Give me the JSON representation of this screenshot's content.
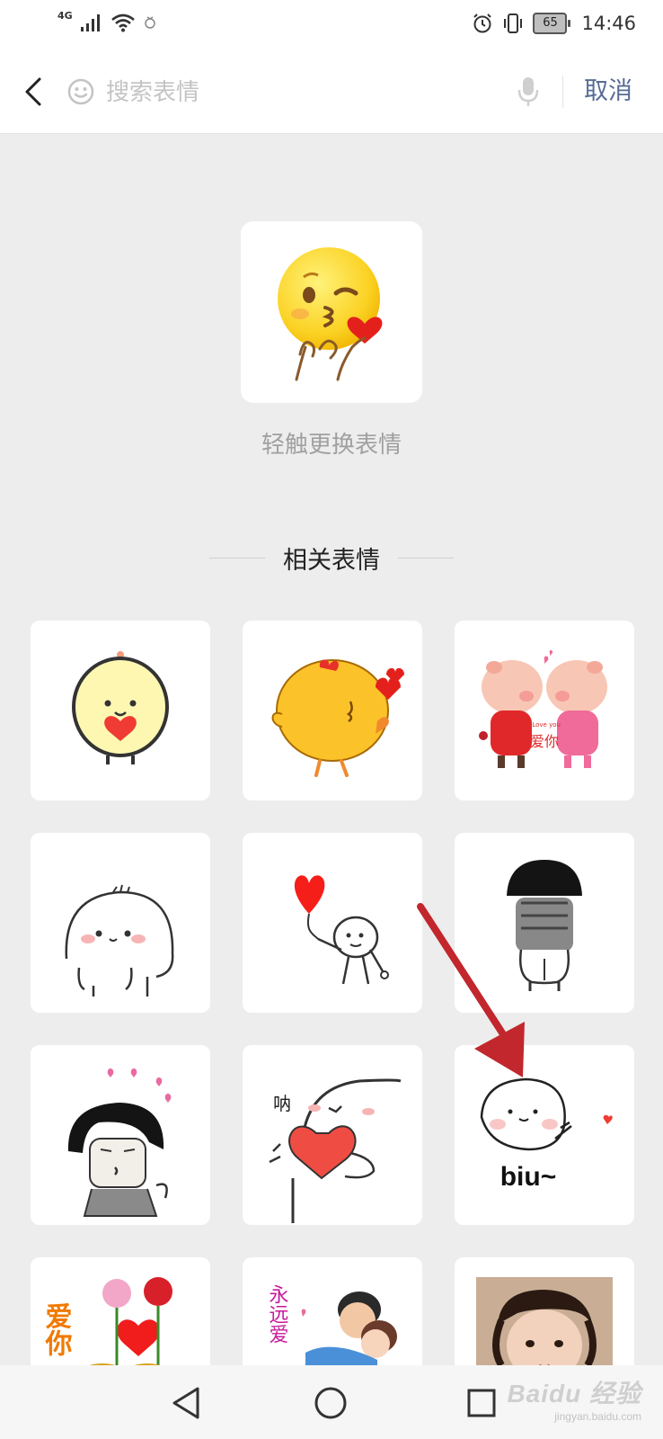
{
  "status_bar": {
    "network": "4G",
    "time": "14:46",
    "battery": "65"
  },
  "search": {
    "placeholder": "搜索表情",
    "value": "",
    "cancel_label": "取消"
  },
  "featured": {
    "hint": "轻触更换表情"
  },
  "related": {
    "title": "相关表情",
    "stickers": [
      {
        "name": "yellow-blob-heart"
      },
      {
        "name": "chick-hearts"
      },
      {
        "name": "pig-kiss-love"
      },
      {
        "name": "bun-shy-blush"
      },
      {
        "name": "stickman-red-balloon"
      },
      {
        "name": "mushroom-head-back"
      },
      {
        "name": "mushroom-kiss-hearts"
      },
      {
        "name": "bun-heart-na"
      },
      {
        "name": "bun-biu"
      },
      {
        "name": "love-roses-hearts"
      },
      {
        "name": "couple-kiss-forever-love"
      },
      {
        "name": "child-photo"
      }
    ],
    "sticker_texts": {
      "pig_love_small": "I Love you",
      "pig_love_big": "爱你",
      "na": "呐",
      "biu": "biu~",
      "love_roses": "爱你",
      "forever_love": "永远爱"
    }
  },
  "watermark": {
    "main": "Baidu 经验",
    "sub": "jingyan.baidu.com"
  },
  "colors": {
    "accent": "#576b95",
    "background": "#ededed",
    "arrow": "#c1272d"
  }
}
